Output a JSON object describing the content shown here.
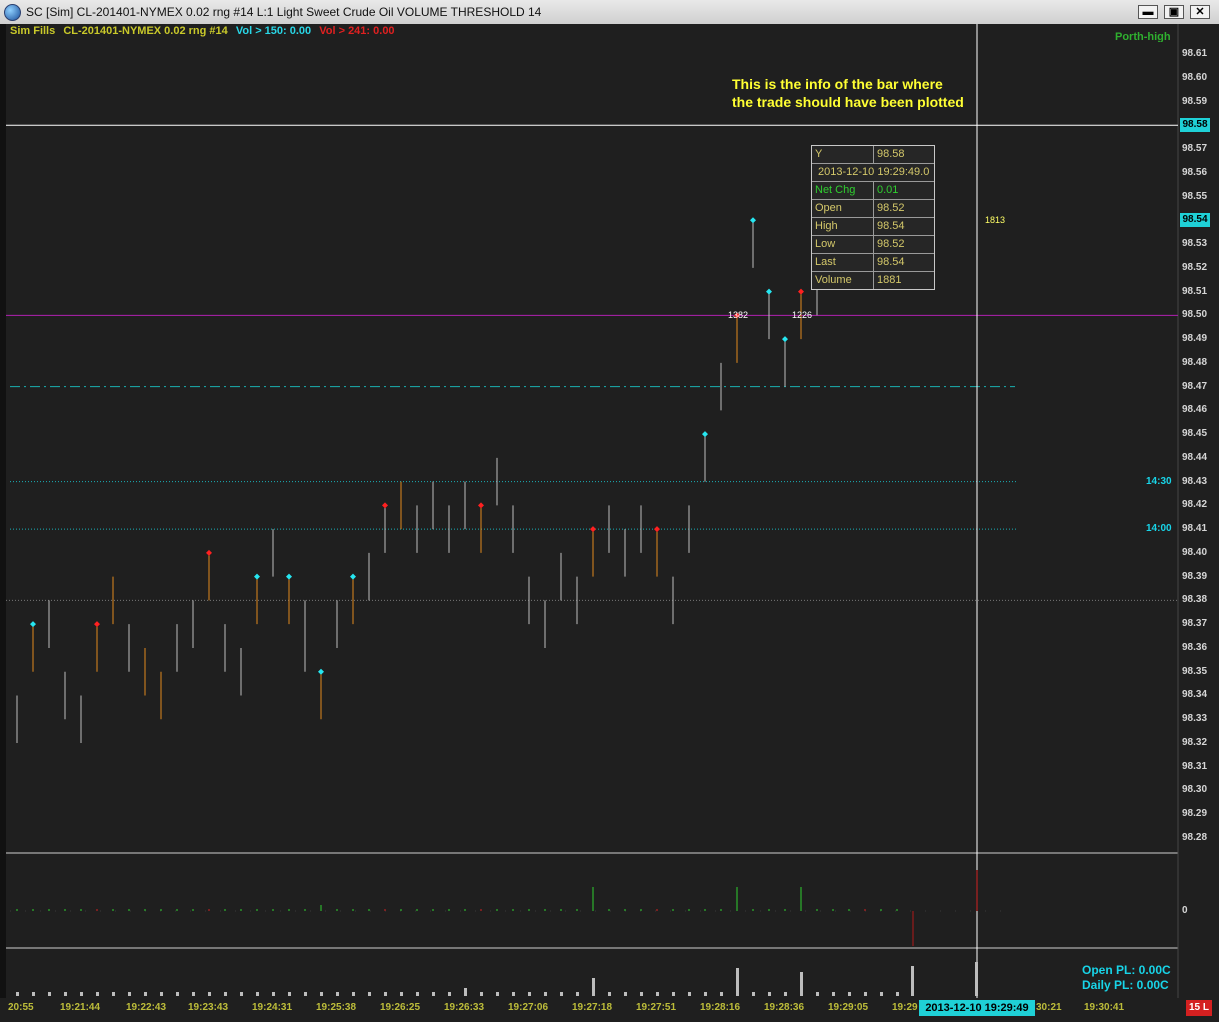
{
  "window": {
    "title": "SC [Sim] CL-201401-NYMEX  0.02 rng  #14  L:1  Light Sweet Crude Oil  VOLUME THRESHOLD 14",
    "minimize": "▬",
    "restore": "▣",
    "close": "✕"
  },
  "legend": {
    "strategy": "Sim Fills",
    "symbol": "CL-201401-NYMEX  0.02 rng  #14",
    "vol_up": "Vol > 150: 0.00",
    "vol_down": "Vol > 241: 0.00",
    "colors": {
      "strategy": "#c9c92a",
      "vol_up": "#29d6e6",
      "vol_down": "#e02020"
    }
  },
  "annotation": {
    "line1": "This is the info of the bar where",
    "line2": "the trade should have been plotted"
  },
  "top_right_label": "Porth-high",
  "data_window": {
    "y_label": "Y",
    "y_value": "98.58",
    "datetime": "2013-12-10   19:29:49.0",
    "rows": [
      {
        "label": "Net Chg",
        "value": "0.01"
      },
      {
        "label": "Open",
        "value": "98.52"
      },
      {
        "label": "High",
        "value": "98.54"
      },
      {
        "label": "Low",
        "value": "98.52"
      },
      {
        "label": "Last",
        "value": "98.54"
      },
      {
        "label": "Volume",
        "value": "1881"
      }
    ]
  },
  "price_axis": {
    "ticks": [
      "98.61",
      "98.60",
      "98.59",
      "98.57",
      "98.56",
      "98.55",
      "98.53",
      "98.52",
      "98.51",
      "98.50",
      "98.49",
      "98.48",
      "98.47",
      "98.46",
      "98.45",
      "98.44",
      "98.43",
      "98.42",
      "98.41",
      "98.40",
      "98.39",
      "98.38",
      "98.37",
      "98.36",
      "98.35",
      "98.34",
      "98.33",
      "98.32",
      "98.31",
      "98.30",
      "98.29",
      "98.28"
    ],
    "crosshair_tag": "98.58",
    "last_tag": "98.54"
  },
  "session_lines": {
    "line_1430": "14:30",
    "line_1400": "14:00"
  },
  "bar_labels": {
    "a": "1382",
    "b": "1226",
    "c": "1813"
  },
  "volume_panel": {
    "zero_label": "0"
  },
  "pl": {
    "open": "Open PL: 0.00C",
    "daily": "Daily PL: 0.00C"
  },
  "time_axis": {
    "ticks": [
      "20:55",
      "19:21:44",
      "19:22:43",
      "19:23:43",
      "19:24:31",
      "19:25:38",
      "19:26:25",
      "19:26:33",
      "19:27:06",
      "19:27:18",
      "19:27:51",
      "19:28:16",
      "19:28:36",
      "19:29:05",
      "19:29",
      "30:21",
      "19:30:41"
    ],
    "crosshair_time": "2013-12-10   19:29:49"
  },
  "badge": "15 L",
  "chart_data": {
    "type": "range bars (HL)",
    "symbol": "CL-201401-NYMEX",
    "bars": [
      {
        "low": 98.32,
        "high": 98.34,
        "color": "gray"
      },
      {
        "low": 98.35,
        "high": 98.37,
        "color": "orange",
        "marker": "cyan"
      },
      {
        "low": 98.36,
        "high": 98.38,
        "color": "gray"
      },
      {
        "low": 98.33,
        "high": 98.35,
        "color": "gray"
      },
      {
        "low": 98.32,
        "high": 98.34,
        "color": "gray"
      },
      {
        "low": 98.35,
        "high": 98.37,
        "color": "orange",
        "marker": "red"
      },
      {
        "low": 98.37,
        "high": 98.39,
        "color": "orange"
      },
      {
        "low": 98.35,
        "high": 98.37,
        "color": "gray"
      },
      {
        "low": 98.34,
        "high": 98.36,
        "color": "orange"
      },
      {
        "low": 98.33,
        "high": 98.35,
        "color": "orange"
      },
      {
        "low": 98.35,
        "high": 98.37,
        "color": "gray"
      },
      {
        "low": 98.36,
        "high": 98.38,
        "color": "gray"
      },
      {
        "low": 98.38,
        "high": 98.4,
        "color": "orange",
        "marker": "red"
      },
      {
        "low": 98.35,
        "high": 98.37,
        "color": "gray"
      },
      {
        "low": 98.34,
        "high": 98.36,
        "color": "gray"
      },
      {
        "low": 98.37,
        "high": 98.39,
        "color": "orange",
        "marker": "cyan"
      },
      {
        "low": 98.39,
        "high": 98.41,
        "color": "gray"
      },
      {
        "low": 98.37,
        "high": 98.39,
        "color": "orange",
        "marker": "cyan"
      },
      {
        "low": 98.35,
        "high": 98.38,
        "color": "gray"
      },
      {
        "low": 98.33,
        "high": 98.35,
        "color": "orange",
        "marker": "cyan"
      },
      {
        "low": 98.36,
        "high": 98.38,
        "color": "gray"
      },
      {
        "low": 98.37,
        "high": 98.39,
        "color": "orange",
        "marker": "cyan"
      },
      {
        "low": 98.38,
        "high": 98.4,
        "color": "gray"
      },
      {
        "low": 98.4,
        "high": 98.42,
        "color": "gray",
        "marker": "red"
      },
      {
        "low": 98.41,
        "high": 98.43,
        "color": "orange"
      },
      {
        "low": 98.4,
        "high": 98.42,
        "color": "gray"
      },
      {
        "low": 98.41,
        "high": 98.43,
        "color": "gray"
      },
      {
        "low": 98.4,
        "high": 98.42,
        "color": "gray"
      },
      {
        "low": 98.41,
        "high": 98.43,
        "color": "gray"
      },
      {
        "low": 98.4,
        "high": 98.42,
        "color": "orange",
        "marker": "red"
      },
      {
        "low": 98.42,
        "high": 98.44,
        "color": "gray"
      },
      {
        "low": 98.4,
        "high": 98.42,
        "color": "gray"
      },
      {
        "low": 98.37,
        "high": 98.39,
        "color": "gray"
      },
      {
        "low": 98.36,
        "high": 98.38,
        "color": "gray"
      },
      {
        "low": 98.38,
        "high": 98.4,
        "color": "gray"
      },
      {
        "low": 98.37,
        "high": 98.39,
        "color": "gray"
      },
      {
        "low": 98.39,
        "high": 98.41,
        "color": "orange",
        "marker": "red"
      },
      {
        "low": 98.4,
        "high": 98.42,
        "color": "gray"
      },
      {
        "low": 98.39,
        "high": 98.41,
        "color": "gray"
      },
      {
        "low": 98.4,
        "high": 98.42,
        "color": "gray"
      },
      {
        "low": 98.39,
        "high": 98.41,
        "color": "orange",
        "marker": "red"
      },
      {
        "low": 98.37,
        "high": 98.39,
        "color": "gray"
      },
      {
        "low": 98.4,
        "high": 98.42,
        "color": "gray"
      },
      {
        "low": 98.43,
        "high": 98.45,
        "color": "gray",
        "marker": "cyan"
      },
      {
        "low": 98.46,
        "high": 98.48,
        "color": "gray"
      },
      {
        "low": 98.48,
        "high": 98.5,
        "color": "orange",
        "marker": "red"
      },
      {
        "low": 98.52,
        "high": 98.54,
        "color": "gray",
        "marker": "cyan"
      },
      {
        "low": 98.49,
        "high": 98.51,
        "color": "gray",
        "marker": "cyan"
      },
      {
        "low": 98.47,
        "high": 98.49,
        "color": "gray",
        "marker": "cyan"
      },
      {
        "low": 98.49,
        "high": 98.51,
        "color": "orange",
        "marker": "red"
      },
      {
        "low": 98.5,
        "high": 98.52,
        "color": "gray"
      },
      {
        "low": 98.55,
        "high": 98.57,
        "color": "gray"
      },
      {
        "low": 98.53,
        "high": 98.55,
        "color": "gray"
      },
      {
        "low": 98.52,
        "high": 98.54,
        "color": "gray",
        "marker": "red"
      },
      {
        "low": 98.54,
        "high": 98.56,
        "color": "orange"
      },
      {
        "low": 98.52,
        "high": 98.54,
        "color": "gray"
      }
    ],
    "horizontal_lines": [
      98.58,
      98.5,
      98.47,
      98.43,
      98.41,
      98.38
    ],
    "ylim": [
      98.27,
      98.62
    ]
  }
}
